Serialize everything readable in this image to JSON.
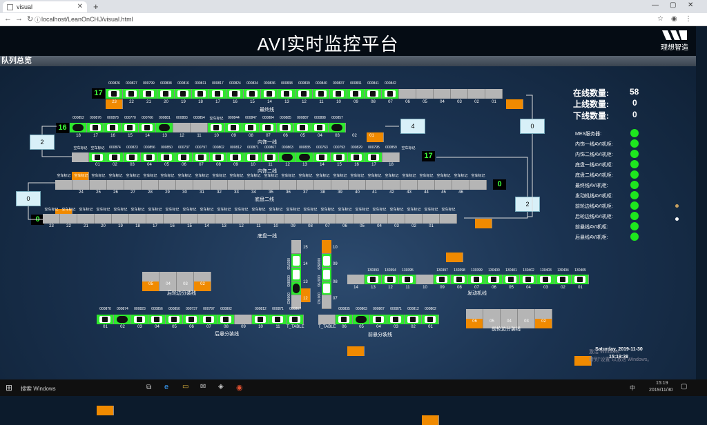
{
  "browser": {
    "tab_title": "visual",
    "url": "localhost/LeanOnCHJ/visual.html"
  },
  "header": {
    "title": "AVI实时监控平台",
    "logo_text": "理想智造"
  },
  "queue_title": "队列总览",
  "stats": {
    "online_label": "在线数量:",
    "online": "58",
    "up_label": "上线数量:",
    "up": "0",
    "down_label": "下线数量:",
    "down": "0"
  },
  "services": [
    "MES服务器:",
    "内饰一线AVI机柜:",
    "内饰二线AVI机柜:",
    "底盘一线AVI机柜:",
    "底盘二线AVI机柜:",
    "最终线AVI机柜:",
    "发动机线AVI机柜:",
    "前轮边线AVI机柜:",
    "后轮边线AVI机柜:",
    "前悬线AVI机柜:",
    "后悬线AVI机柜:"
  ],
  "colors": {
    "occupied": "#2ee82e",
    "empty": "#b5b5b5",
    "station": "#f08a00",
    "online": "#1ee61e"
  },
  "lanes": {
    "final": {
      "name": "最终线",
      "count": "17",
      "ids": [
        "000826",
        "000827",
        "000799",
        "000808",
        "000816",
        "000811",
        "000817",
        "000824",
        "000834",
        "000836",
        "000838",
        "000839",
        "000840",
        "000837",
        "000831",
        "000841",
        "000842",
        "空车标记",
        "空车标记",
        "空车标记",
        "空车标记",
        "空车标记",
        "空车标记"
      ],
      "nums": [
        "23",
        "22",
        "21",
        "20",
        "19",
        "18",
        "17",
        "16",
        "15",
        "14",
        "13",
        "12",
        "11",
        "10",
        "09",
        "08",
        "07",
        "06",
        "05",
        "04",
        "03",
        "02",
        "01"
      ]
    },
    "trim1": {
      "name": "内饰一线",
      "count": "16",
      "ids": [
        "000852",
        "000876",
        "000878",
        "000770",
        "000766",
        "000881",
        "000883",
        "000854",
        "空车标记",
        "000844",
        "000847",
        "000884",
        "000885",
        "000887",
        "000888",
        "000857"
      ],
      "nums": [
        "18",
        "17",
        "16",
        "15",
        "14",
        "13",
        "12",
        "11",
        "10",
        "09",
        "08",
        "07",
        "06",
        "05",
        "04",
        "03",
        "02",
        "01"
      ]
    },
    "trim2": {
      "name": "内饰二线",
      "count": "17",
      "ids": [
        "空车标记",
        "空车标记",
        "000874",
        "000823",
        "000856",
        "000850",
        "000737",
        "000797",
        "000802",
        "000812",
        "000871",
        "000867",
        "000863",
        "000835",
        "000763",
        "000793",
        "000829",
        "000795",
        "000859",
        "空车标记"
      ],
      "nums": [
        "01",
        "02",
        "03",
        "04",
        "05",
        "06",
        "07",
        "08",
        "09",
        "10",
        "11",
        "12",
        "13",
        "14",
        "15",
        "16",
        "17",
        "18"
      ]
    },
    "chassis2": {
      "name": "底盘二线",
      "count": "0",
      "ids": [
        "空车标记",
        "空车标记",
        "空车标记",
        "空车标记",
        "空车标记",
        "空车标记",
        "空车标记",
        "空车标记",
        "空车标记",
        "空车标记",
        "空车标记",
        "空车标记",
        "空车标记",
        "空车标记",
        "空车标记",
        "空车标记",
        "空车标记",
        "空车标记",
        "空车标记",
        "空车标记",
        "空车标记",
        "空车标记",
        "空车标记",
        "空车标记",
        "空车标记"
      ],
      "nums": [
        "24",
        "25",
        "26",
        "27",
        "28",
        "29",
        "30",
        "31",
        "32",
        "33",
        "34",
        "35",
        "36",
        "37",
        "38",
        "39",
        "40",
        "41",
        "42",
        "43",
        "44",
        "45",
        "46"
      ]
    },
    "chassis1": {
      "name": "底盘一线",
      "count": "0",
      "ids": [
        "空车标记",
        "空车标记",
        "空车标记",
        "空车标记",
        "空车标记",
        "空车标记",
        "空车标记",
        "空车标记",
        "空车标记",
        "空车标记",
        "空车标记",
        "空车标记",
        "空车标记",
        "空车标记",
        "空车标记",
        "空车标记",
        "空车标记",
        "空车标记",
        "空车标记",
        "空车标记",
        "空车标记",
        "空车标记",
        "空车标记",
        "空车标记"
      ],
      "nums": [
        "23",
        "22",
        "21",
        "20",
        "19",
        "18",
        "17",
        "16",
        "15",
        "14",
        "13",
        "12",
        "11",
        "10",
        "09",
        "08",
        "07",
        "06",
        "05",
        "04",
        "03",
        "02",
        "01"
      ]
    },
    "engine": {
      "name": "发动机线",
      "ids": [
        "130393",
        "130394",
        "130395",
        "",
        "130397",
        "130398",
        "130399",
        "130400",
        "130401",
        "130402",
        "130403",
        "130404",
        "130405"
      ],
      "nums": [
        "14",
        "13",
        "12",
        "11",
        "10",
        "09",
        "08",
        "07",
        "06",
        "05",
        "04",
        "03",
        "02",
        "01"
      ]
    },
    "rear_wheel": {
      "name": "后轮边分装线",
      "nums": [
        "05",
        "04",
        "03",
        "02"
      ]
    },
    "front_wheel": {
      "name": "前轮边分装线",
      "nums": [
        "06",
        "05",
        "04",
        "03",
        "02"
      ]
    },
    "rear_susp": {
      "name": "后悬分装线",
      "ids": [
        "000870",
        "000874",
        "000823",
        "000856",
        "000850",
        "000737",
        "000797",
        "000802",
        "",
        "000812",
        "000871",
        "000867"
      ],
      "nums": [
        "01",
        "02",
        "03",
        "04",
        "05",
        "06",
        "07",
        "08",
        "09",
        "10",
        "11",
        "T_TABLE"
      ]
    },
    "front_susp": {
      "name": "前悬分装线",
      "ids": [
        "",
        "000835",
        "000863",
        "000867",
        "000871",
        "000812",
        "000802"
      ],
      "nums": [
        "T_TABLE",
        "06",
        "05",
        "04",
        "03",
        "02",
        "01"
      ]
    },
    "v_left": {
      "ids": [
        "000763",
        "000803",
        "000863"
      ],
      "nums": [
        "15",
        "14",
        "13",
        "12"
      ]
    },
    "v_right": {
      "ids": [
        "000829",
        "000793",
        "000763"
      ],
      "nums": [
        "10",
        "09",
        "08",
        "07"
      ]
    }
  },
  "boxes": {
    "b0a": "0",
    "b4": "4",
    "b2a": "2",
    "b0b": "0",
    "b2b": "2"
  },
  "footer": {
    "date": "Saturday, 2019-11-30",
    "time": "15:19:38",
    "activate": "激活 Windows",
    "activate_sub": "转到\"设置\"以激活 Windows。"
  },
  "taskbar": {
    "search": "搜索 Windows",
    "clock": "15:19",
    "date": "2019/11/30",
    "ime": "中"
  }
}
